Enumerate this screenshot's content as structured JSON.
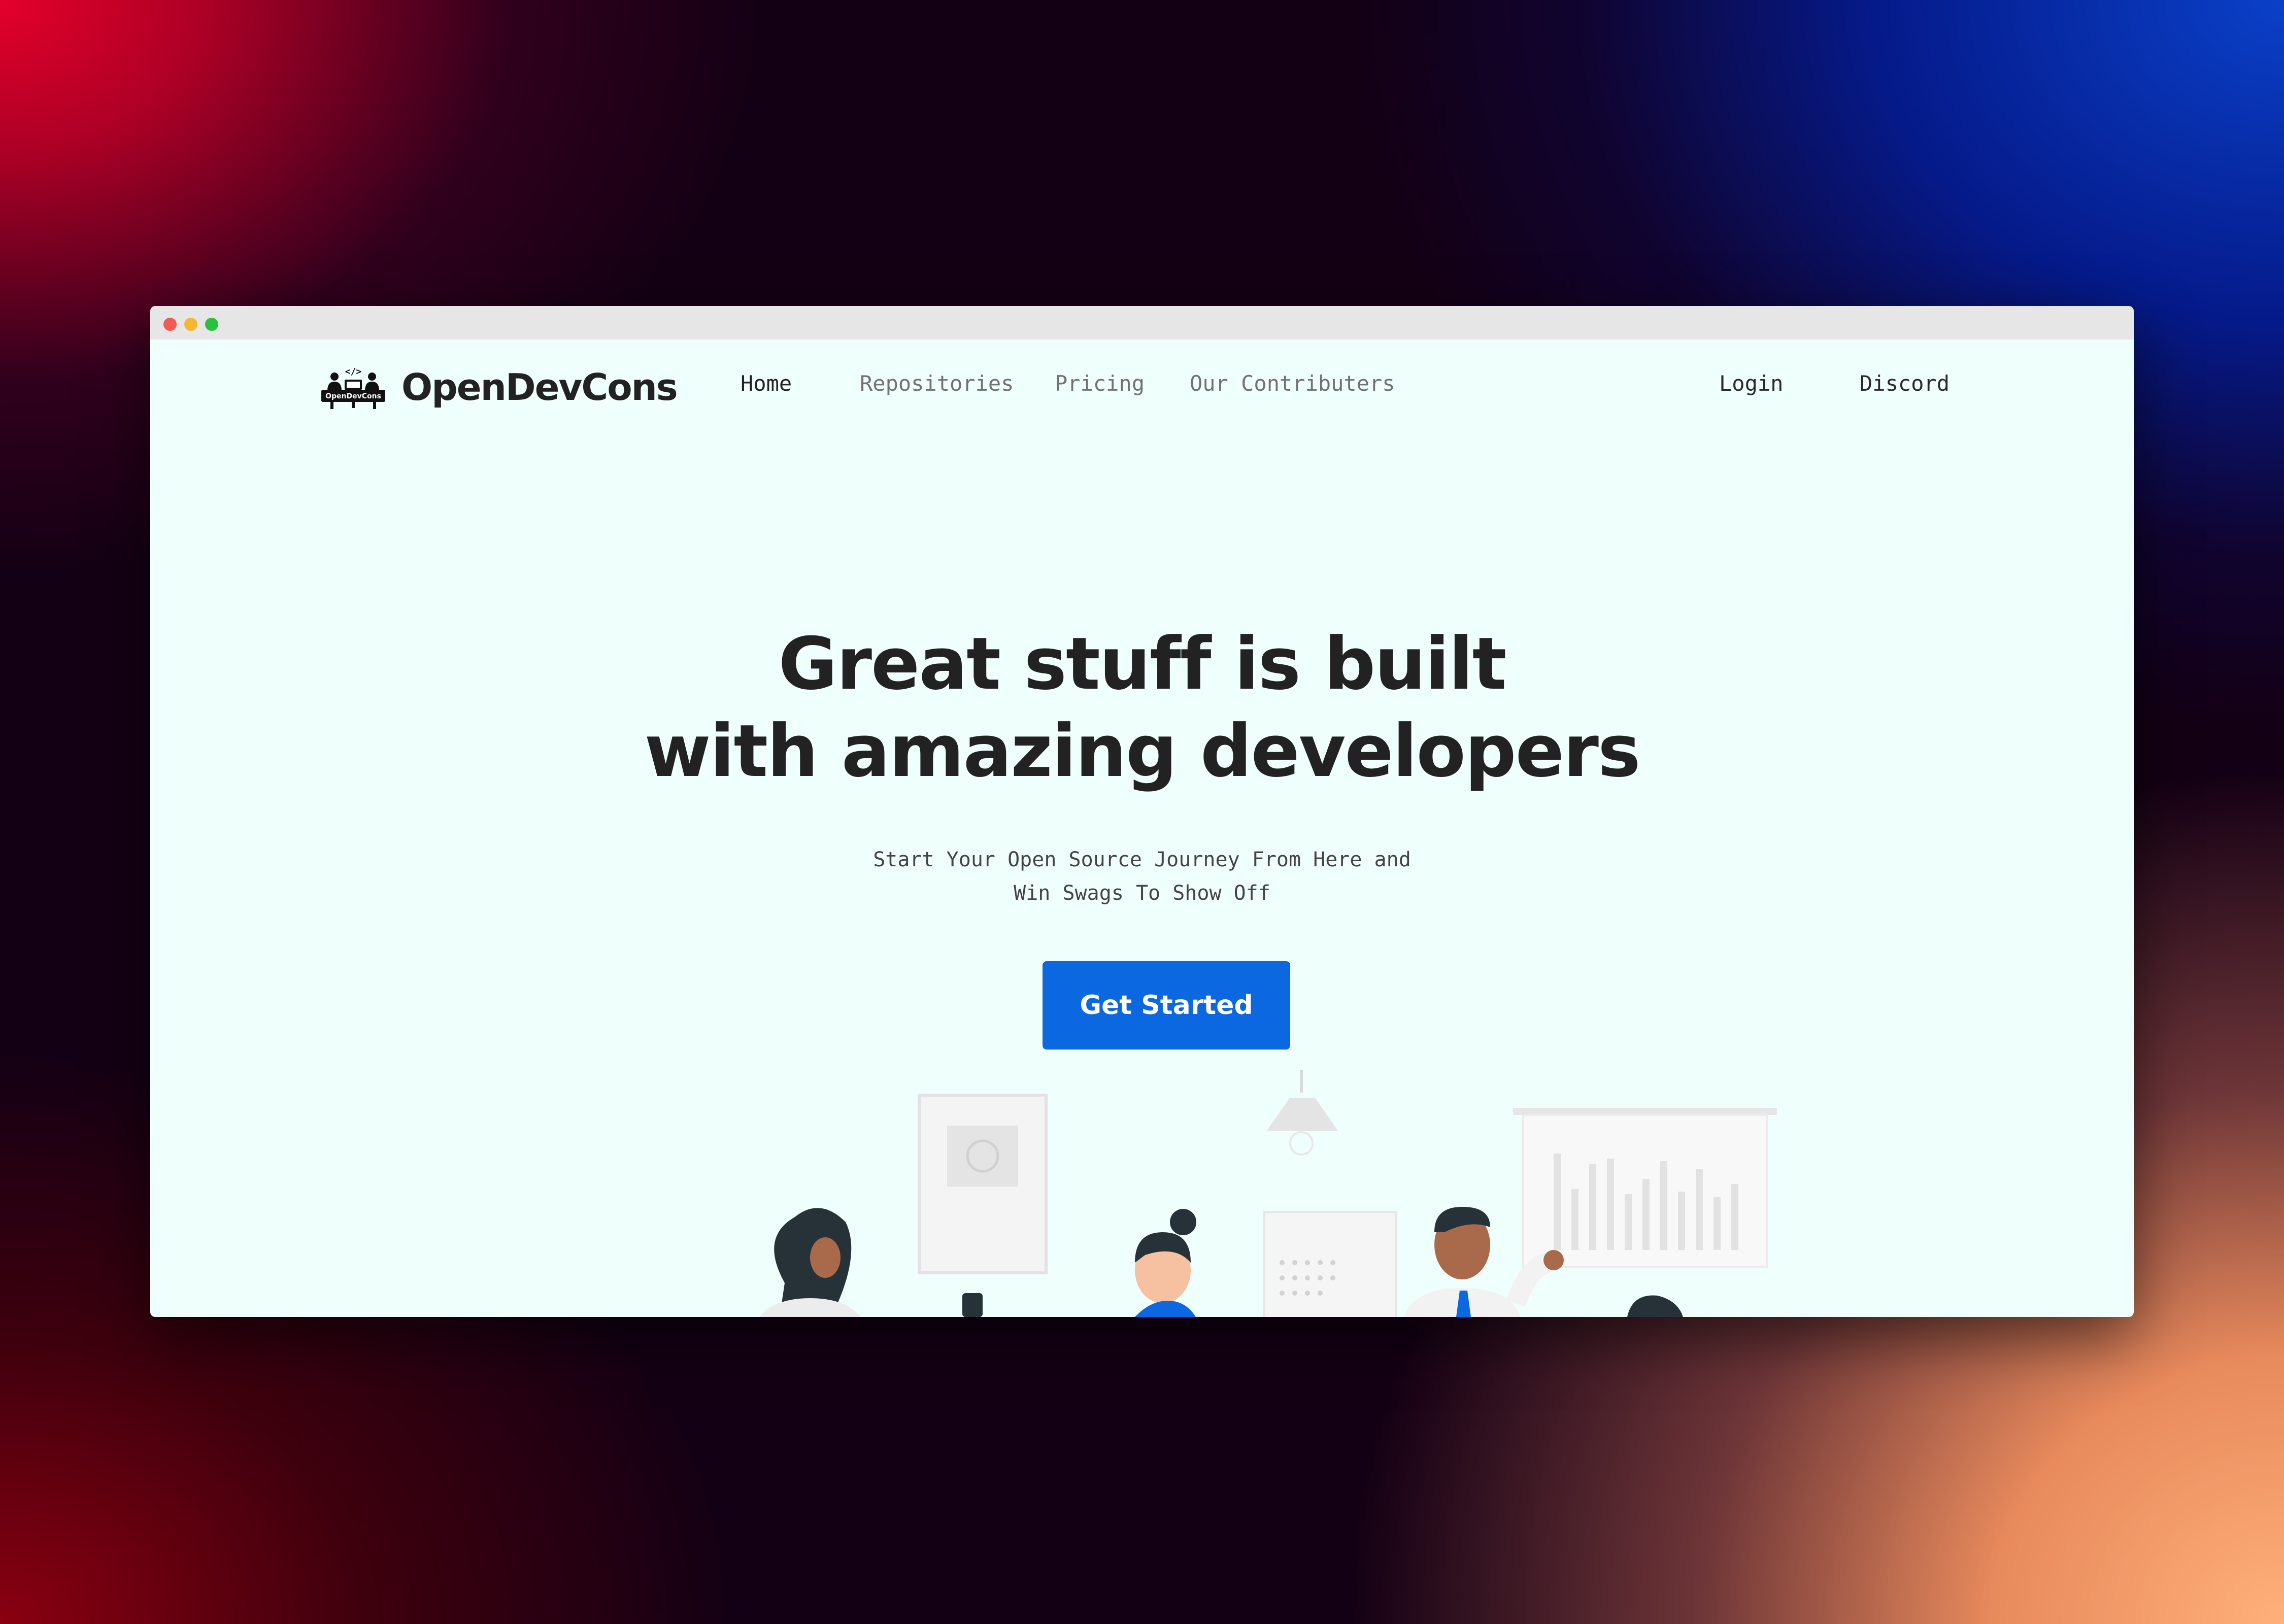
{
  "window": {
    "controls": [
      "close",
      "minimize",
      "maximize"
    ]
  },
  "brand": {
    "name": "OpenDevCons",
    "logo_text": "OpenDevCons",
    "logo_code": "</>",
    "logo_icon": "developers-at-desk-logo"
  },
  "nav": {
    "links": [
      {
        "label": "Home",
        "active": true
      },
      {
        "label": "Repositories",
        "active": false
      },
      {
        "label": "Pricing",
        "active": false
      },
      {
        "label": "Our Contributers",
        "active": false
      }
    ],
    "login": "Login",
    "discord": "Discord"
  },
  "hero": {
    "title_line1": "Great stuff is built",
    "title_line2": "with amazing developers",
    "subtitle_line1": "Start Your Open Source Journey From Here and",
    "subtitle_line2": "Win Swags To Show Off",
    "cta_label": "Get Started"
  },
  "colors": {
    "page_bg": "#effffc",
    "accent": "#0b68e0",
    "text_dark": "#222222",
    "nav_muted": "#727272"
  },
  "illustration": {
    "icon": "office-team-illustration"
  }
}
